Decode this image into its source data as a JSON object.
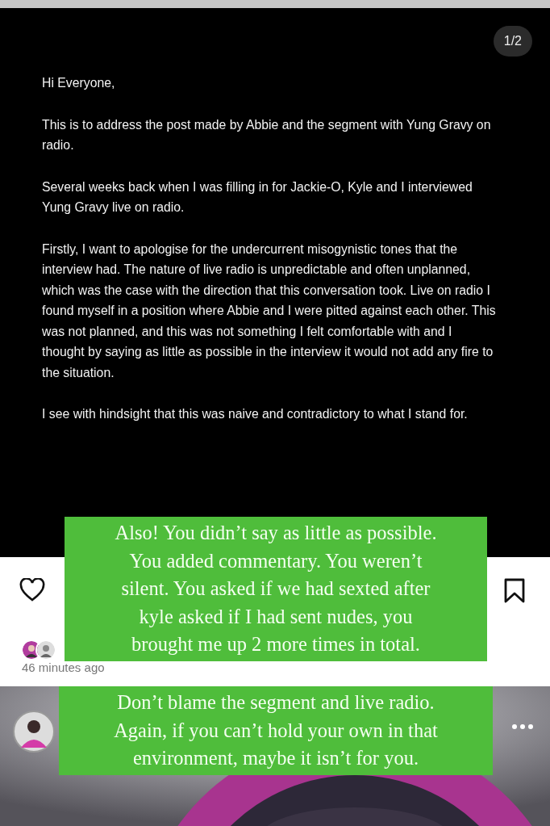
{
  "post": {
    "page_indicator": "1/2",
    "paragraphs": [
      "Hi Everyone,",
      "This is to address the post made by Abbie and the segment with Yung Gravy on radio.",
      "Several weeks back when I was filling in for Jackie-O, Kyle and I interviewed Yung Gravy live on radio.",
      "Firstly, I want to apologise for the undercurrent misogynistic tones that the interview had.  The nature of live radio is unpredictable and often unplanned, which was the case with the direction that this conversation took.  Live on radio I found myself in a position where Abbie and I were pitted against each other. This was not planned, and this was not something I felt comfortable with and I thought by saying as little as possible in the interview it would not add any fire to the situation.",
      "I see with hindsight that this was naive and contradictory to what I stand for."
    ],
    "timestamp": "46 minutes ago"
  },
  "stickers": [
    {
      "lines": [
        "Also! You didn’t say as little as possible.",
        "You added commentary. You weren’t",
        "silent. You asked if we had sexted after",
        "kyle asked if I had sent nudes, you",
        "brought me up 2 more times in total."
      ]
    },
    {
      "lines": [
        "Don’t blame the segment and live radio.",
        "Again, if you can’t hold your own in that",
        "environment, maybe it isn’t for you."
      ]
    }
  ]
}
